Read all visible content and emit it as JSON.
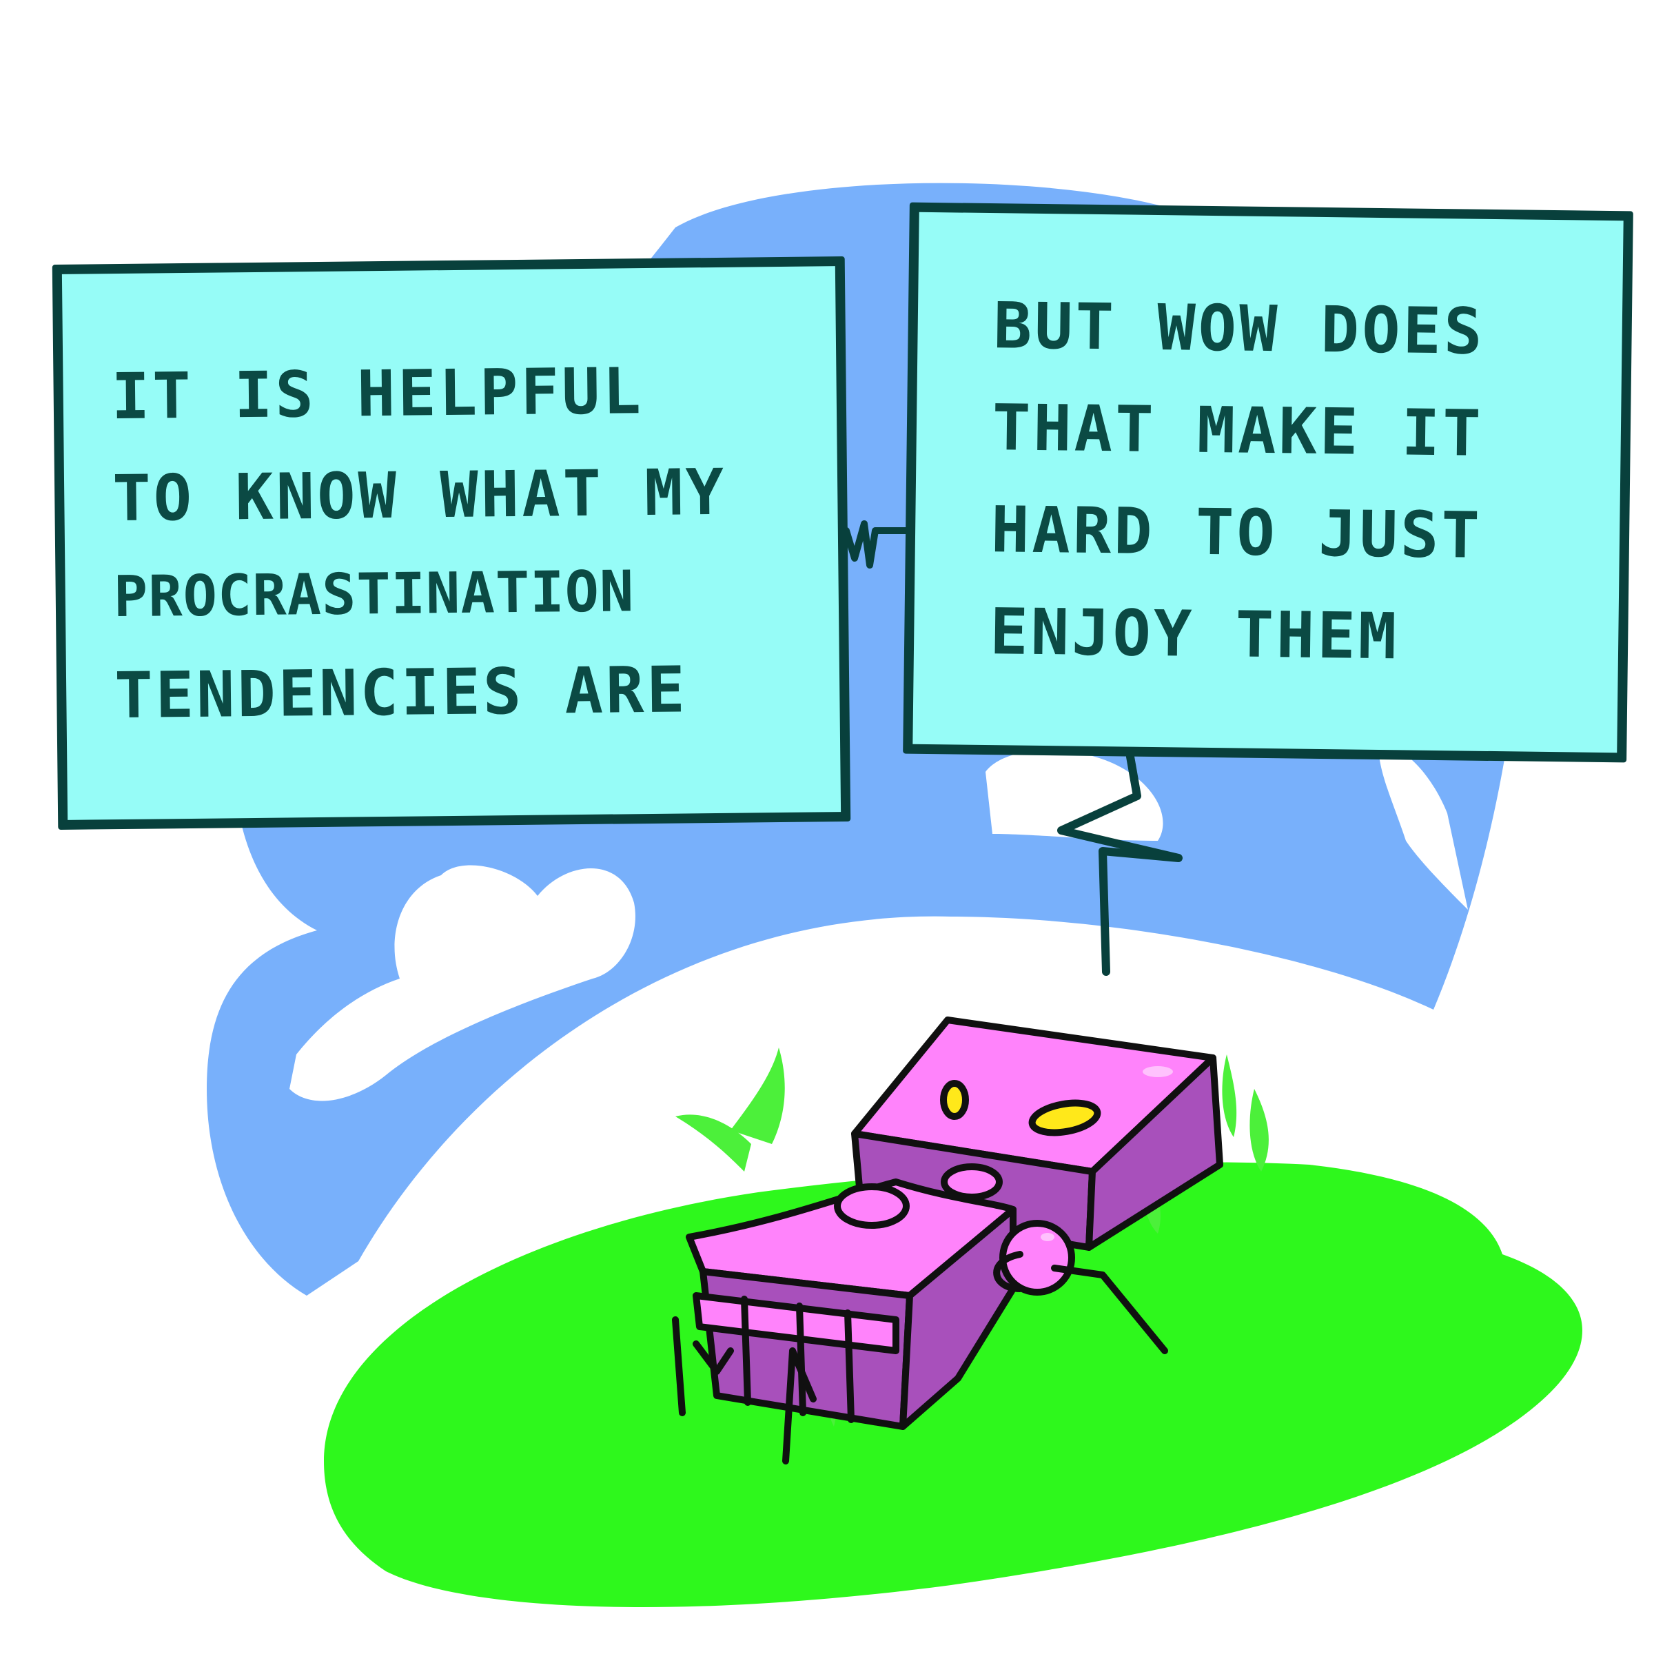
{
  "comic": {
    "caption_left": {
      "lines": [
        "IT IS HELPFUL",
        "TO KNOW WHAT MY",
        "PROCRASTINATION",
        "TENDENCIES ARE"
      ]
    },
    "caption_right": {
      "lines": [
        "BUT WOW DOES",
        "THAT MAKE IT",
        "HARD TO JUST",
        "ENJOY THEM"
      ]
    },
    "characters": [
      {
        "name": "pink-block-robot",
        "pose": "lying on back in grass"
      }
    ]
  },
  "colors": {
    "background": "#ffffff",
    "sky_blob": "#78b0fb",
    "caption_fill": "#96fcf7",
    "caption_border": "#08403c",
    "caption_text": "#0b4a44",
    "grass": "#2ef81c",
    "grass_blades": "#4cf03a",
    "robot_top": "#ff83fb",
    "robot_side": "#a850bb",
    "robot_eyes": "#ffe81a",
    "outline": "#101010"
  }
}
